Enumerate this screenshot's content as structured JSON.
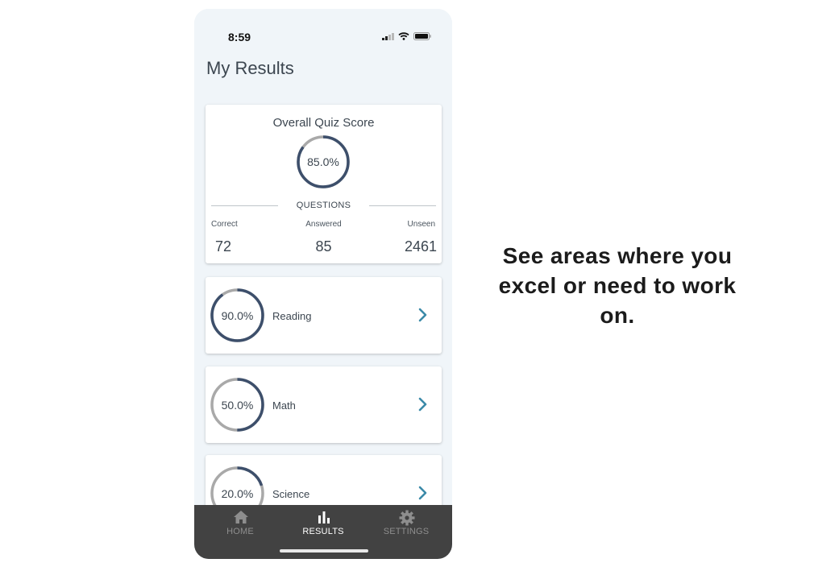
{
  "status_bar": {
    "time": "8:59"
  },
  "page": {
    "title": "My Results"
  },
  "overall": {
    "title": "Overall Quiz Score",
    "score_label": "85.0%",
    "score_fraction": 0.85,
    "questions_heading": "QUESTIONS",
    "stats": [
      {
        "label": "Correct",
        "value": "72"
      },
      {
        "label": "Answered",
        "value": "85"
      },
      {
        "label": "Unseen",
        "value": "2461"
      }
    ]
  },
  "categories": [
    {
      "name": "Reading",
      "score_label": "90.0%",
      "score_fraction": 0.9
    },
    {
      "name": "Math",
      "score_label": "50.0%",
      "score_fraction": 0.5
    },
    {
      "name": "Science",
      "score_label": "20.0%",
      "score_fraction": 0.2
    }
  ],
  "tab_bar": {
    "tabs": [
      {
        "label": "HOME",
        "icon": "home-icon",
        "active": false
      },
      {
        "label": "RESULTS",
        "icon": "bar-chart-icon",
        "active": true
      },
      {
        "label": "SETTINGS",
        "icon": "gear-icon",
        "active": false
      }
    ]
  },
  "tagline": "See areas where you excel or need to work on.",
  "colors": {
    "ring_progress": "#3d4f6b",
    "ring_track": "#a9a9a9",
    "chevron": "#3b8aa8",
    "tab_bar": "#424242",
    "tab_active": "#ffffff",
    "tab_inactive": "#8e8e8e"
  }
}
